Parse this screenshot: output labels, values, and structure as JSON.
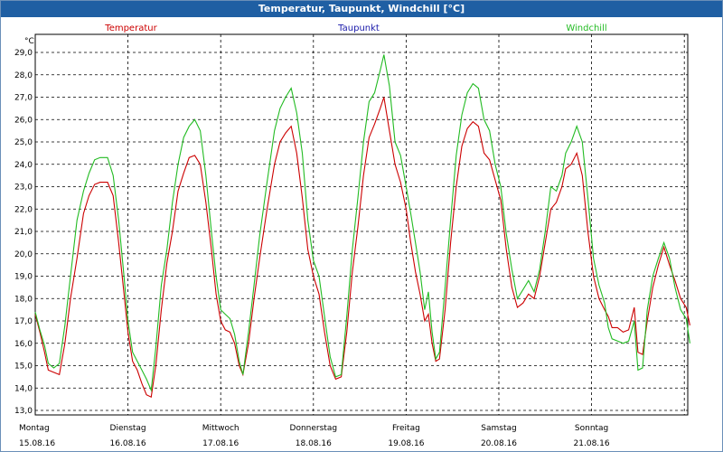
{
  "window": {
    "title": "Temperatur, Taupunkt, Windchill [°C]"
  },
  "chart_data": {
    "type": "line",
    "title": "Temperatur, Taupunkt, Windchill [°C]",
    "ylabel": "°C",
    "ylim": [
      13.0,
      29.0
    ],
    "xlim": [
      0,
      7
    ],
    "grid": true,
    "legend_position": "top",
    "y_ticks": [
      "13,0",
      "14,0",
      "15,0",
      "16,0",
      "17,0",
      "18,0",
      "19,0",
      "20,0",
      "21,0",
      "22,0",
      "23,0",
      "24,0",
      "25,0",
      "26,0",
      "27,0",
      "28,0",
      "29,0"
    ],
    "x_ticks": [
      {
        "day": "Montag",
        "date": "15.08.16"
      },
      {
        "day": "Dienstag",
        "date": "16.08.16"
      },
      {
        "day": "Mittwoch",
        "date": "17.08.16"
      },
      {
        "day": "Donnerstag",
        "date": "18.08.16"
      },
      {
        "day": "Freitag",
        "date": "19.08.16"
      },
      {
        "day": "Samstag",
        "date": "20.08.16"
      },
      {
        "day": "Sonntag",
        "date": "21.08.16"
      }
    ],
    "series": [
      {
        "name": "Temperatur",
        "color": "#cc0000",
        "points": [
          [
            0.0,
            17.3
          ],
          [
            0.05,
            16.5
          ],
          [
            0.1,
            15.6
          ],
          [
            0.14,
            14.8
          ],
          [
            0.2,
            14.7
          ],
          [
            0.26,
            14.6
          ],
          [
            0.32,
            16.0
          ],
          [
            0.38,
            18.0
          ],
          [
            0.45,
            19.8
          ],
          [
            0.52,
            21.8
          ],
          [
            0.58,
            22.6
          ],
          [
            0.64,
            23.1
          ],
          [
            0.7,
            23.2
          ],
          [
            0.78,
            23.2
          ],
          [
            0.84,
            22.6
          ],
          [
            0.9,
            20.5
          ],
          [
            0.95,
            18.5
          ],
          [
            1.0,
            16.5
          ],
          [
            1.05,
            15.2
          ],
          [
            1.1,
            14.8
          ],
          [
            1.15,
            14.2
          ],
          [
            1.2,
            13.7
          ],
          [
            1.25,
            13.6
          ],
          [
            1.3,
            15.0
          ],
          [
            1.36,
            17.5
          ],
          [
            1.42,
            19.6
          ],
          [
            1.48,
            21.0
          ],
          [
            1.54,
            22.8
          ],
          [
            1.6,
            23.6
          ],
          [
            1.66,
            24.3
          ],
          [
            1.72,
            24.4
          ],
          [
            1.78,
            24.0
          ],
          [
            1.84,
            22.3
          ],
          [
            1.9,
            20.2
          ],
          [
            1.95,
            18.2
          ],
          [
            2.0,
            17.0
          ],
          [
            2.05,
            16.6
          ],
          [
            2.1,
            16.5
          ],
          [
            2.15,
            16.0
          ],
          [
            2.2,
            15.0
          ],
          [
            2.24,
            14.6
          ],
          [
            2.3,
            16.0
          ],
          [
            2.36,
            18.0
          ],
          [
            2.42,
            19.8
          ],
          [
            2.5,
            22.0
          ],
          [
            2.58,
            24.0
          ],
          [
            2.64,
            25.0
          ],
          [
            2.7,
            25.4
          ],
          [
            2.76,
            25.7
          ],
          [
            2.82,
            24.5
          ],
          [
            2.88,
            22.5
          ],
          [
            2.94,
            20.2
          ],
          [
            3.0,
            19.0
          ],
          [
            3.06,
            18.2
          ],
          [
            3.12,
            16.5
          ],
          [
            3.18,
            15.0
          ],
          [
            3.24,
            14.4
          ],
          [
            3.3,
            14.5
          ],
          [
            3.36,
            16.5
          ],
          [
            3.42,
            19.2
          ],
          [
            3.48,
            21.2
          ],
          [
            3.54,
            23.5
          ],
          [
            3.6,
            25.2
          ],
          [
            3.66,
            25.8
          ],
          [
            3.72,
            26.5
          ],
          [
            3.76,
            27.0
          ],
          [
            3.82,
            25.5
          ],
          [
            3.88,
            24.0
          ],
          [
            3.94,
            23.2
          ],
          [
            4.0,
            22.0
          ],
          [
            4.05,
            20.5
          ],
          [
            4.1,
            19.2
          ],
          [
            4.15,
            18.2
          ],
          [
            4.2,
            17.0
          ],
          [
            4.24,
            17.3
          ],
          [
            4.28,
            16.0
          ],
          [
            4.32,
            15.2
          ],
          [
            4.36,
            15.3
          ],
          [
            4.42,
            17.5
          ],
          [
            4.48,
            20.5
          ],
          [
            4.54,
            23.0
          ],
          [
            4.6,
            24.8
          ],
          [
            4.66,
            25.6
          ],
          [
            4.72,
            25.9
          ],
          [
            4.78,
            25.7
          ],
          [
            4.84,
            24.5
          ],
          [
            4.9,
            24.2
          ],
          [
            4.96,
            23.3
          ],
          [
            5.02,
            22.4
          ],
          [
            5.08,
            20.2
          ],
          [
            5.14,
            18.5
          ],
          [
            5.2,
            17.6
          ],
          [
            5.26,
            17.8
          ],
          [
            5.32,
            18.2
          ],
          [
            5.38,
            18.0
          ],
          [
            5.44,
            19.0
          ],
          [
            5.5,
            20.5
          ],
          [
            5.56,
            22.0
          ],
          [
            5.62,
            22.3
          ],
          [
            5.68,
            23.0
          ],
          [
            5.72,
            23.8
          ],
          [
            5.78,
            24.0
          ],
          [
            5.84,
            24.5
          ],
          [
            5.9,
            23.5
          ],
          [
            5.96,
            21.0
          ],
          [
            6.02,
            19.0
          ],
          [
            6.08,
            18.0
          ],
          [
            6.14,
            17.5
          ],
          [
            6.18,
            17.2
          ],
          [
            6.22,
            16.7
          ],
          [
            6.28,
            16.7
          ],
          [
            6.34,
            16.5
          ],
          [
            6.4,
            16.6
          ],
          [
            6.46,
            17.6
          ],
          [
            6.5,
            15.6
          ],
          [
            6.55,
            15.5
          ],
          [
            6.6,
            17.0
          ],
          [
            6.66,
            18.5
          ],
          [
            6.72,
            19.5
          ],
          [
            6.78,
            20.3
          ],
          [
            6.84,
            19.5
          ],
          [
            6.9,
            18.8
          ],
          [
            6.96,
            18.0
          ],
          [
            7.02,
            17.6
          ],
          [
            7.06,
            16.8
          ]
        ]
      },
      {
        "name": "Taupunkt",
        "color": "#1a1aaa",
        "points": []
      },
      {
        "name": "Windchill",
        "color": "#22bb22",
        "points": [
          [
            0.0,
            17.4
          ],
          [
            0.05,
            16.6
          ],
          [
            0.1,
            15.9
          ],
          [
            0.14,
            15.1
          ],
          [
            0.2,
            14.9
          ],
          [
            0.26,
            15.1
          ],
          [
            0.32,
            16.8
          ],
          [
            0.38,
            19.0
          ],
          [
            0.45,
            21.5
          ],
          [
            0.52,
            22.8
          ],
          [
            0.58,
            23.6
          ],
          [
            0.64,
            24.2
          ],
          [
            0.7,
            24.3
          ],
          [
            0.78,
            24.3
          ],
          [
            0.84,
            23.5
          ],
          [
            0.9,
            21.5
          ],
          [
            0.95,
            19.3
          ],
          [
            1.0,
            17.0
          ],
          [
            1.05,
            15.6
          ],
          [
            1.1,
            15.2
          ],
          [
            1.15,
            14.8
          ],
          [
            1.2,
            14.4
          ],
          [
            1.25,
            13.9
          ],
          [
            1.3,
            15.8
          ],
          [
            1.36,
            18.6
          ],
          [
            1.42,
            20.2
          ],
          [
            1.48,
            22.3
          ],
          [
            1.54,
            24.0
          ],
          [
            1.6,
            25.2
          ],
          [
            1.66,
            25.7
          ],
          [
            1.72,
            26.0
          ],
          [
            1.78,
            25.5
          ],
          [
            1.84,
            23.5
          ],
          [
            1.9,
            21.0
          ],
          [
            1.95,
            19.0
          ],
          [
            2.0,
            17.5
          ],
          [
            2.05,
            17.3
          ],
          [
            2.1,
            17.1
          ],
          [
            2.15,
            16.4
          ],
          [
            2.2,
            15.2
          ],
          [
            2.24,
            14.6
          ],
          [
            2.3,
            16.5
          ],
          [
            2.36,
            18.6
          ],
          [
            2.42,
            20.8
          ],
          [
            2.5,
            23.2
          ],
          [
            2.58,
            25.5
          ],
          [
            2.64,
            26.5
          ],
          [
            2.7,
            27.0
          ],
          [
            2.76,
            27.4
          ],
          [
            2.82,
            26.3
          ],
          [
            2.88,
            24.5
          ],
          [
            2.94,
            21.5
          ],
          [
            3.0,
            19.7
          ],
          [
            3.06,
            19.0
          ],
          [
            3.12,
            17.2
          ],
          [
            3.18,
            15.4
          ],
          [
            3.24,
            14.5
          ],
          [
            3.3,
            14.6
          ],
          [
            3.36,
            17.2
          ],
          [
            3.42,
            20.2
          ],
          [
            3.48,
            22.5
          ],
          [
            3.54,
            25.0
          ],
          [
            3.6,
            26.8
          ],
          [
            3.66,
            27.2
          ],
          [
            3.72,
            28.2
          ],
          [
            3.76,
            28.9
          ],
          [
            3.82,
            27.5
          ],
          [
            3.88,
            25.0
          ],
          [
            3.94,
            24.4
          ],
          [
            4.0,
            23.0
          ],
          [
            4.05,
            21.8
          ],
          [
            4.1,
            20.5
          ],
          [
            4.15,
            19.2
          ],
          [
            4.2,
            17.5
          ],
          [
            4.24,
            18.3
          ],
          [
            4.28,
            16.5
          ],
          [
            4.32,
            15.3
          ],
          [
            4.36,
            15.6
          ],
          [
            4.42,
            18.5
          ],
          [
            4.48,
            21.5
          ],
          [
            4.54,
            24.4
          ],
          [
            4.6,
            26.2
          ],
          [
            4.66,
            27.2
          ],
          [
            4.72,
            27.6
          ],
          [
            4.78,
            27.4
          ],
          [
            4.84,
            26.0
          ],
          [
            4.9,
            25.5
          ],
          [
            4.96,
            24.0
          ],
          [
            5.02,
            23.0
          ],
          [
            5.08,
            20.9
          ],
          [
            5.14,
            19.3
          ],
          [
            5.2,
            18.0
          ],
          [
            5.26,
            18.4
          ],
          [
            5.32,
            18.8
          ],
          [
            5.38,
            18.3
          ],
          [
            5.44,
            19.3
          ],
          [
            5.5,
            21.0
          ],
          [
            5.56,
            23.0
          ],
          [
            5.62,
            22.8
          ],
          [
            5.68,
            23.5
          ],
          [
            5.72,
            24.5
          ],
          [
            5.78,
            25.0
          ],
          [
            5.84,
            25.7
          ],
          [
            5.9,
            25.0
          ],
          [
            5.96,
            22.5
          ],
          [
            6.02,
            19.8
          ],
          [
            6.08,
            18.6
          ],
          [
            6.14,
            17.8
          ],
          [
            6.18,
            16.7
          ],
          [
            6.22,
            16.2
          ],
          [
            6.28,
            16.1
          ],
          [
            6.34,
            16.0
          ],
          [
            6.4,
            16.1
          ],
          [
            6.46,
            17.0
          ],
          [
            6.5,
            14.8
          ],
          [
            6.55,
            14.9
          ],
          [
            6.6,
            17.5
          ],
          [
            6.66,
            19.0
          ],
          [
            6.72,
            19.8
          ],
          [
            6.78,
            20.5
          ],
          [
            6.84,
            19.8
          ],
          [
            6.9,
            18.5
          ],
          [
            6.96,
            17.5
          ],
          [
            7.02,
            17.1
          ],
          [
            7.06,
            16.0
          ]
        ]
      }
    ]
  }
}
